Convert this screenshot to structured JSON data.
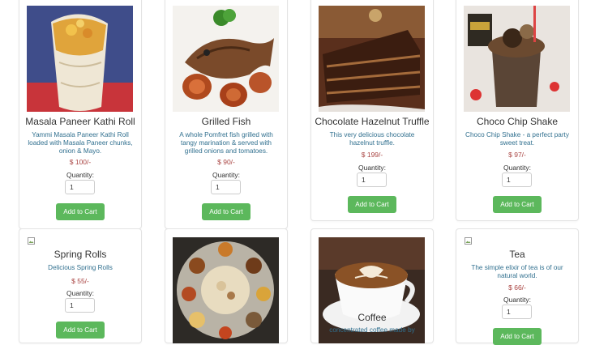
{
  "products": [
    {
      "name": "Masala Paneer Kathi Roll",
      "description": "Yammi Masala Paneer Kathi Roll loaded with Masala Paneer chunks, onion & Mayo.",
      "price": "$ 100/-",
      "quantity_label": "Quantity:",
      "quantity": "1",
      "button": "Add to Cart",
      "image_icon": "kathi-roll-photo"
    },
    {
      "name": "Grilled Fish",
      "description": "A whole Pomfret fish grilled with tangy marination & served with grilled onions and tomatoes.",
      "price": "$ 90/-",
      "quantity_label": "Quantity:",
      "quantity": "1",
      "button": "Add to Cart",
      "image_icon": "grilled-fish-photo"
    },
    {
      "name": "Chocolate Hazelnut Truffle",
      "description": "This very delicious chocolate hazelnut truffle.",
      "price": "$ 199/-",
      "quantity_label": "Quantity:",
      "quantity": "1",
      "button": "Add to Cart",
      "image_icon": "truffle-cake-photo"
    },
    {
      "name": "Choco Chip Shake",
      "description": "Choco Chip Shake - a perfect party sweet treat.",
      "price": "$ 97/-",
      "quantity_label": "Quantity:",
      "quantity": "1",
      "button": "Add to Cart",
      "image_icon": "shake-photo"
    },
    {
      "name": "Spring Rolls",
      "description": "Delicious Spring Rolls",
      "price": "$ 55/-",
      "quantity_label": "Quantity:",
      "quantity": "1",
      "button": "Add to Cart",
      "image_icon": "broken-image-icon"
    },
    {
      "image_icon": "thali-photo"
    },
    {
      "name": "Coffee",
      "description": "concentrated coffee made by",
      "image_icon": "coffee-photo"
    },
    {
      "name": "Tea",
      "description": "The simple elixir of tea is of our natural world.",
      "price": "$ 66/-",
      "quantity_label": "Quantity:",
      "quantity": "1",
      "button": "Add to Cart",
      "image_icon": "broken-image-icon"
    }
  ],
  "colors": {
    "price": "#a94442",
    "description": "#31708f",
    "button": "#5cb85c"
  }
}
